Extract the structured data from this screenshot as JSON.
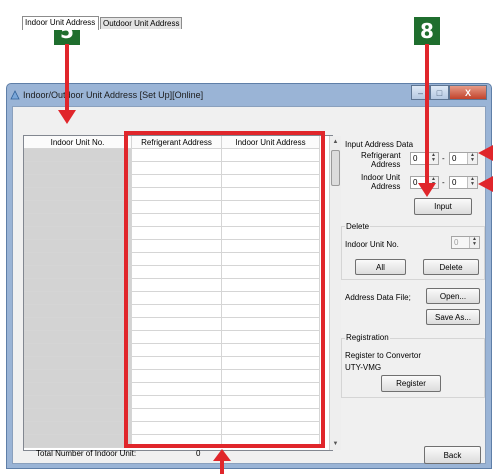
{
  "callouts": {
    "five": "5",
    "eight": "8"
  },
  "window": {
    "title": "Indoor/Outdoor Unit Address [Set Up][Online]",
    "app_icon": "app-icon",
    "controls": {
      "minimize": "–",
      "maximize": "□",
      "close": "X"
    }
  },
  "tabs": [
    {
      "label": "Indoor Unit Address",
      "active": true
    },
    {
      "label": "Outdoor Unit Address",
      "active": false
    }
  ],
  "table": {
    "columns": [
      "Indoor Unit No.",
      "Refrigerant Address",
      "Indoor Unit Address"
    ],
    "row_count": 23
  },
  "footer": {
    "total_label": "Total Number of Indoor Unit:",
    "total_value": "0"
  },
  "input_data": {
    "group_label": "Input Address Data",
    "refrigerant_label_1": "Refrigerant",
    "refrigerant_label_2": "Address",
    "indoor_label_1": "Indoor Unit",
    "indoor_label_2": "Address",
    "refrigerant_from": "0",
    "refrigerant_to": "0",
    "indoor_from": "0",
    "indoor_to": "0",
    "dash": "-",
    "input_button": "Input"
  },
  "delete": {
    "group_label": "Delete",
    "unit_label": "Indoor Unit No.",
    "unit_value": "0",
    "all_button": "All",
    "delete_button": "Delete"
  },
  "file": {
    "label": "Address Data File;",
    "open_button": "Open...",
    "save_button": "Save As..."
  },
  "registration": {
    "group_label": "Registration",
    "register_to": "Register to Convertor",
    "model": "UTY-VMG",
    "register_button": "Register"
  },
  "back_button": "Back",
  "colors": {
    "callout_bg": "#1f6e2e",
    "highlight_red": "#e0262b",
    "window_frame": "#9ab4d6"
  }
}
